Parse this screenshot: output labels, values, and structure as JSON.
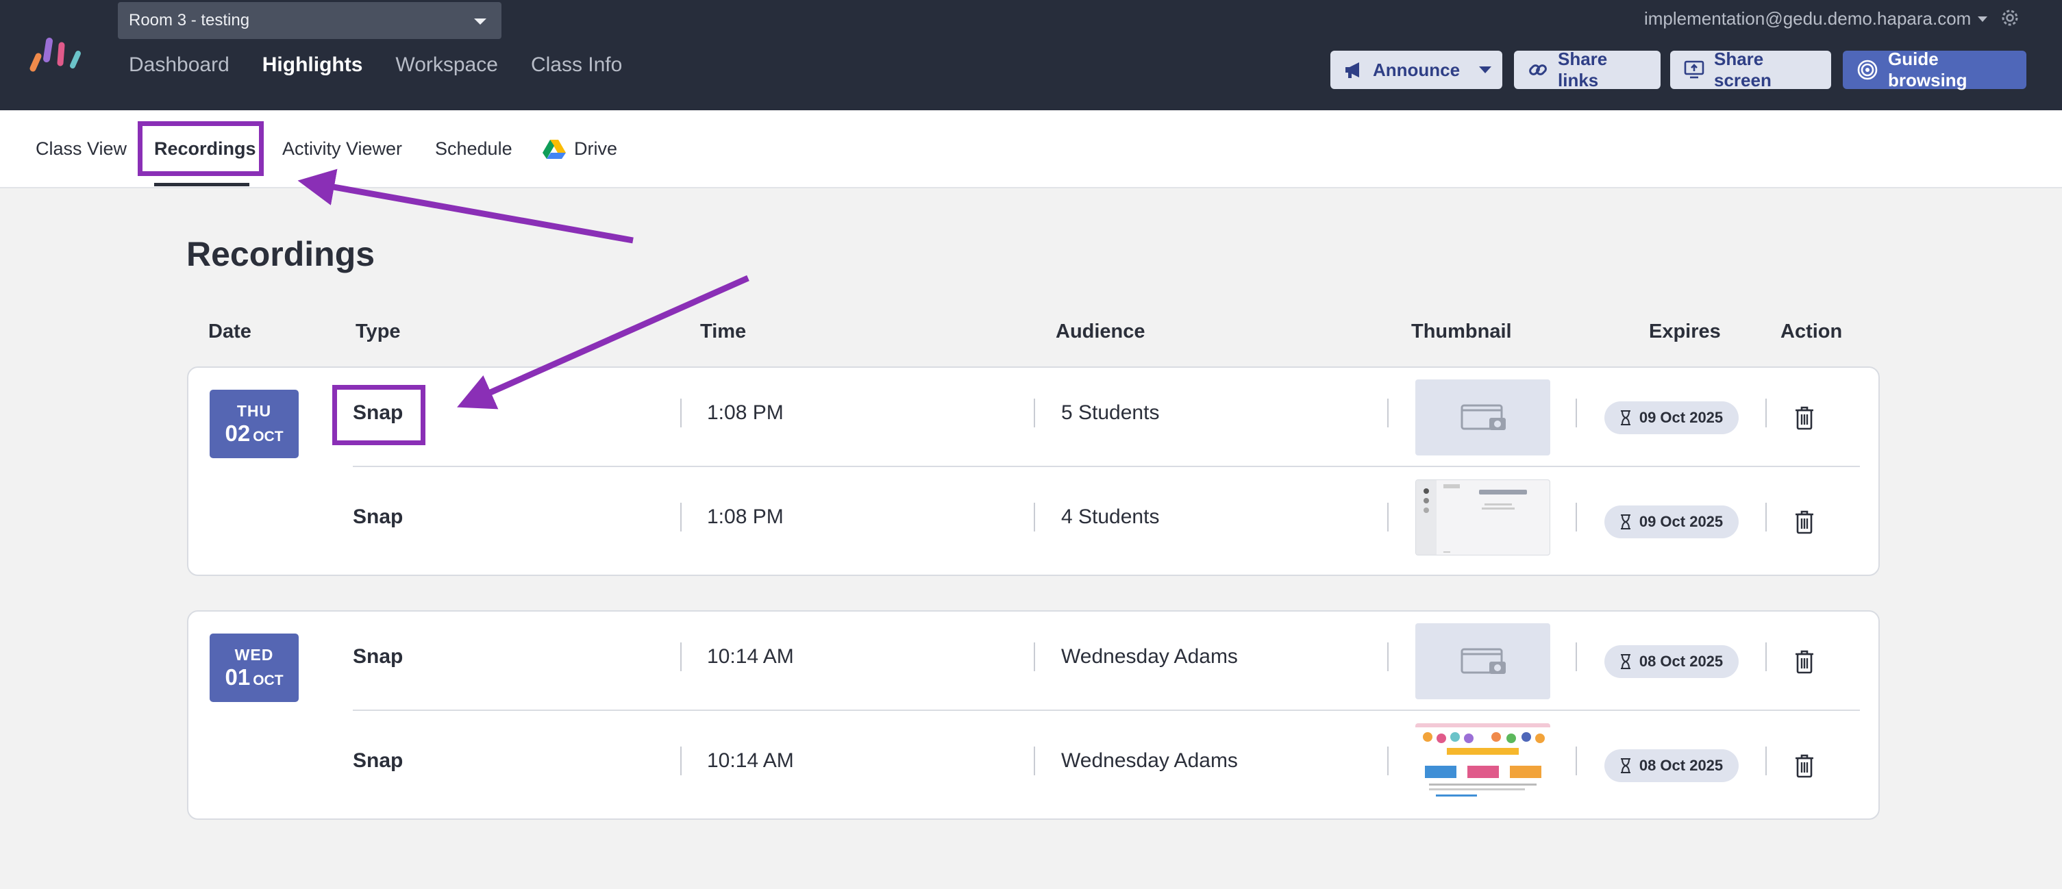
{
  "room_selector": {
    "value": "Room 3 - testing"
  },
  "main_nav": [
    {
      "label": "Dashboard"
    },
    {
      "label": "Highlights"
    },
    {
      "label": "Workspace"
    },
    {
      "label": "Class Info"
    }
  ],
  "account": {
    "email": "implementation@gedu.demo.hapara.com"
  },
  "toolbar": {
    "announce": "Announce",
    "share_links": "Share links",
    "share_screen": "Share screen",
    "guide_browsing": "Guide browsing"
  },
  "sub_nav": [
    {
      "label": "Class View"
    },
    {
      "label": "Recordings"
    },
    {
      "label": "Activity Viewer"
    },
    {
      "label": "Schedule"
    },
    {
      "label": "Drive"
    }
  ],
  "page": {
    "title": "Recordings"
  },
  "columns": {
    "date": "Date",
    "type": "Type",
    "time": "Time",
    "audience": "Audience",
    "thumbnail": "Thumbnail",
    "expires": "Expires",
    "action": "Action"
  },
  "groups": [
    {
      "dow": "THU",
      "day": "02",
      "month": "OCT",
      "rows": [
        {
          "type": "Snap",
          "time": "1:08 PM",
          "audience": "5 Students",
          "thumbnail": "placeholder-image-icon",
          "expires": "09 Oct 2025"
        },
        {
          "type": "Snap",
          "time": "1:08 PM",
          "audience": "4 Students",
          "thumbnail": "screenshot-preview",
          "expires": "09 Oct 2025"
        }
      ]
    },
    {
      "dow": "WED",
      "day": "01",
      "month": "OCT",
      "rows": [
        {
          "type": "Snap",
          "time": "10:14 AM",
          "audience": "Wednesday Adams",
          "thumbnail": "placeholder-image-icon",
          "expires": "08 Oct 2025"
        },
        {
          "type": "Snap",
          "time": "10:14 AM",
          "audience": "Wednesday Adams",
          "thumbnail": "webpage-preview",
          "expires": "08 Oct 2025"
        }
      ]
    }
  ],
  "colors": {
    "topbar": "#272d3b",
    "accent": "#4f67b9",
    "date_badge": "#5566b3",
    "annotation": "#8a2fb6"
  }
}
